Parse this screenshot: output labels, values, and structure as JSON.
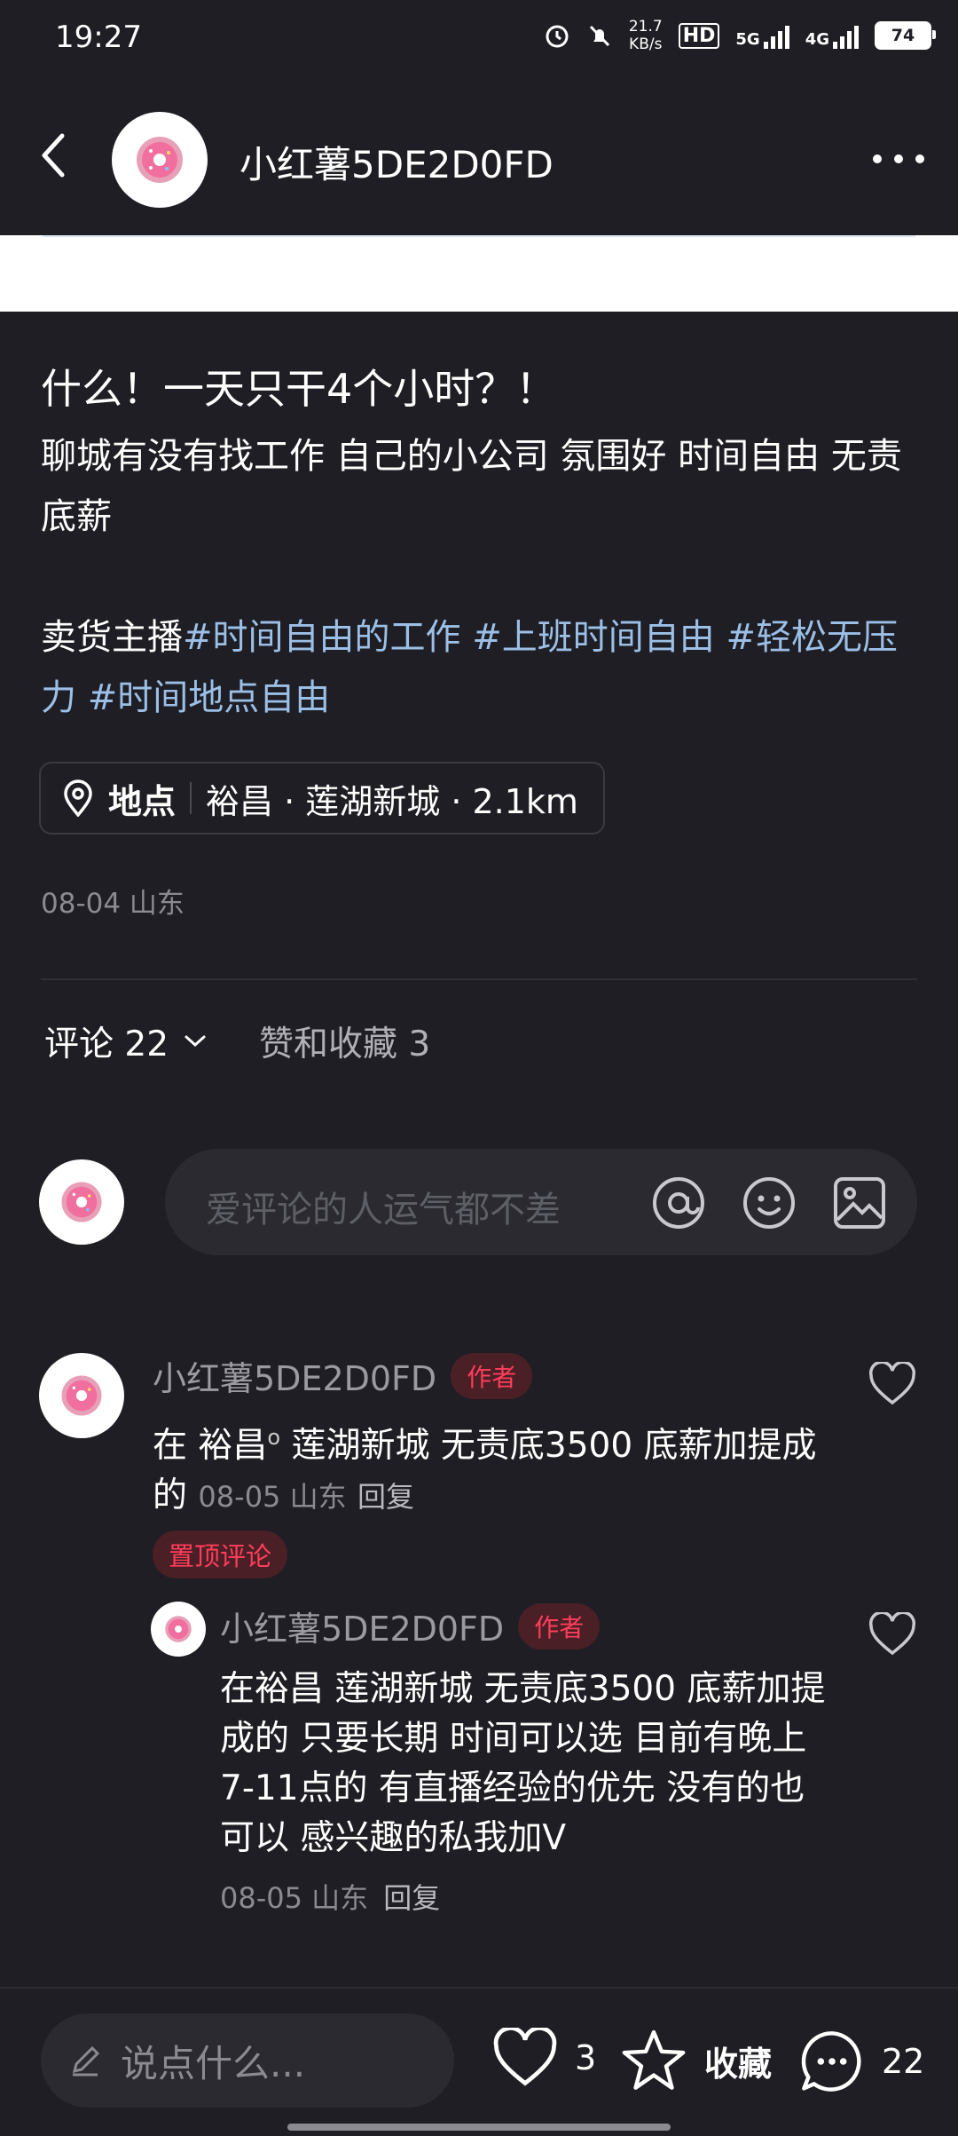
{
  "status_bar": {
    "time": "19:27",
    "net_speed_value": "21.7",
    "net_speed_unit": "KB/s",
    "hd": "HD",
    "net1": "5G",
    "net2": "4G",
    "battery": "74"
  },
  "header": {
    "username": "小红薯5DE2D0FD"
  },
  "post": {
    "title": "什么！一天只干4个小时？！",
    "body": "聊城有没有找工作 自己的小公司 氛围好 时间自由 无责底薪",
    "prefix": "卖货主播",
    "tags": [
      "#时间自由的工作",
      "#上班时间自由",
      "#轻松无压力",
      "#时间地点自由"
    ],
    "location_label": "地点",
    "location_value": "裕昌 · 莲湖新城 · 2.1km",
    "date": "08-04 山东"
  },
  "tabs": {
    "comments": "评论 22",
    "likes_collects": "赞和收藏 3"
  },
  "comment_input": {
    "placeholder": "爱评论的人运气都不差"
  },
  "comments": [
    {
      "author": "小红薯5DE2D0FD",
      "badge": "作者",
      "text_part1": "在 ",
      "link": "裕昌",
      "text_part2": " 莲湖新城   无责底3500  底薪加提成的",
      "meta": "08-05 山东",
      "reply": "回复",
      "pinned": "置顶评论"
    },
    {
      "author": "小红薯5DE2D0FD",
      "badge": "作者",
      "text": "在裕昌 莲湖新城   无责底3500  底薪加提成的 只要长期 时间可以选 目前有晚上7-11点的 有直播经验的优先 没有的也可以 感兴趣的私我加V",
      "meta": "08-05 山东",
      "reply": "回复"
    }
  ],
  "bottom_bar": {
    "say_placeholder": "说点什么...",
    "like_count": "3",
    "collect_label": "收藏",
    "comment_count": "22"
  }
}
